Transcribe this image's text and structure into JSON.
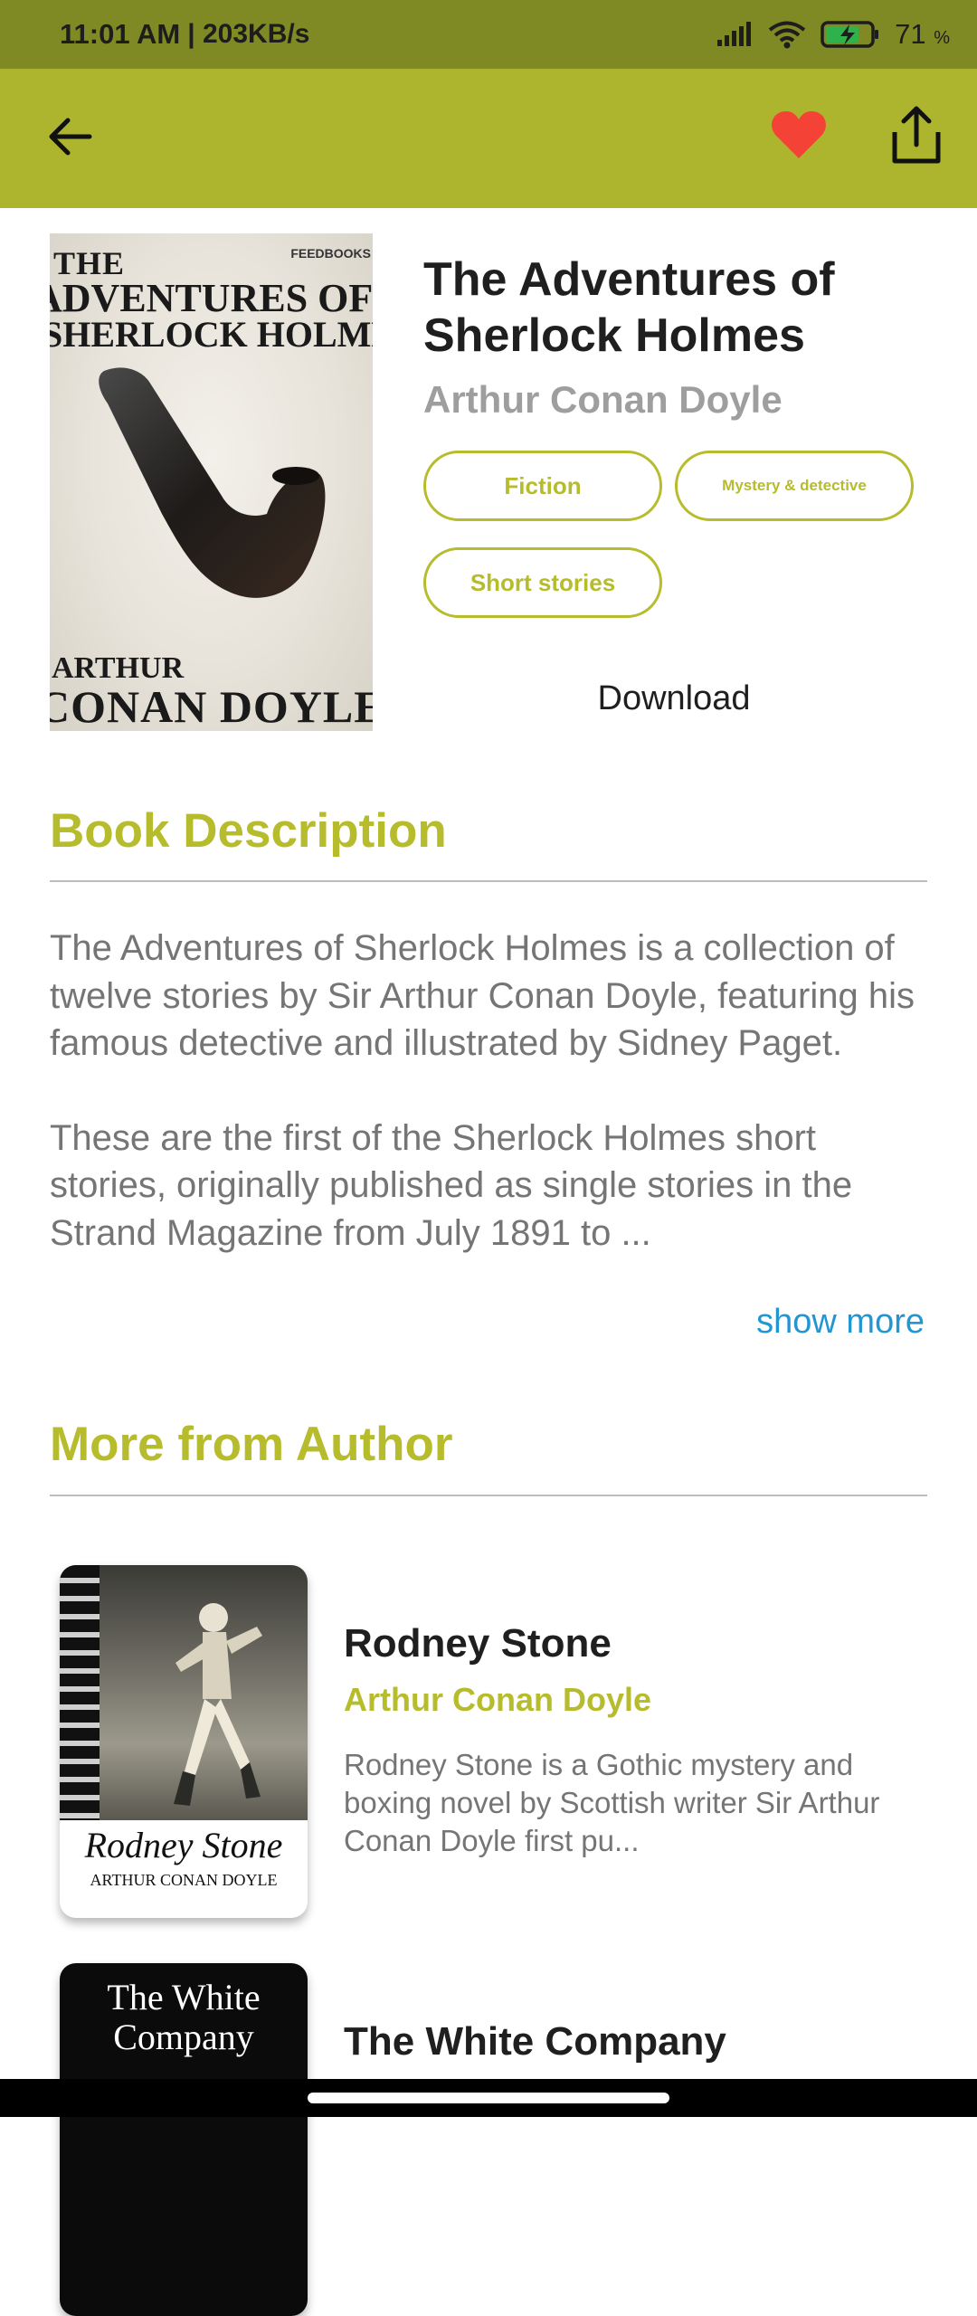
{
  "status_bar": {
    "time": "11:01 AM",
    "net_speed": "| 203KB/s",
    "battery_level": "71",
    "battery_unit": "%"
  },
  "app_bar": {
    "back_icon": "arrow-left-icon",
    "favorite_icon": "heart-icon",
    "share_icon": "share-upload-icon",
    "background_color": "#adb52f",
    "favorite_color": "#f44336"
  },
  "book": {
    "title": "The Adventures of Sherlock Holmes",
    "author": "Arthur Conan Doyle",
    "cover": {
      "publisher": "FEEDBOOKS",
      "line1": "THE",
      "line2": "ADVENTURES OF",
      "line3": "SHERLOCK HOLMES",
      "author_line1": "ARTHUR",
      "author_line2": "CONAN DOYLE"
    },
    "genres": [
      "Fiction",
      "Mystery & detective",
      "Short stories"
    ],
    "download_label": "Download"
  },
  "description": {
    "heading": "Book Description",
    "paragraph1": "The Adventures of Sherlock Holmes is a collection of twelve stories by Sir Arthur Conan Doyle, featuring his famous detective and illustrated by Sidney Paget.",
    "paragraph2": "These are the first of the Sherlock Holmes short stories, originally published as single stories in the Strand Magazine from July 1891 to ...",
    "show_more_label": "show more"
  },
  "more_from_author": {
    "heading": "More from Author",
    "items": [
      {
        "title": "Rodney Stone",
        "author": "Arthur Conan Doyle",
        "description": "Rodney Stone is a Gothic mystery and boxing novel by Scottish writer Sir Arthur Conan Doyle first pu...",
        "cover_title": "Rodney Stone",
        "cover_author": "ARTHUR CONAN DOYLE"
      },
      {
        "title": "The White Company",
        "cover_title": "The White Company"
      }
    ]
  },
  "theme": {
    "accent": "#b6bc2c",
    "link": "#2196d3"
  }
}
